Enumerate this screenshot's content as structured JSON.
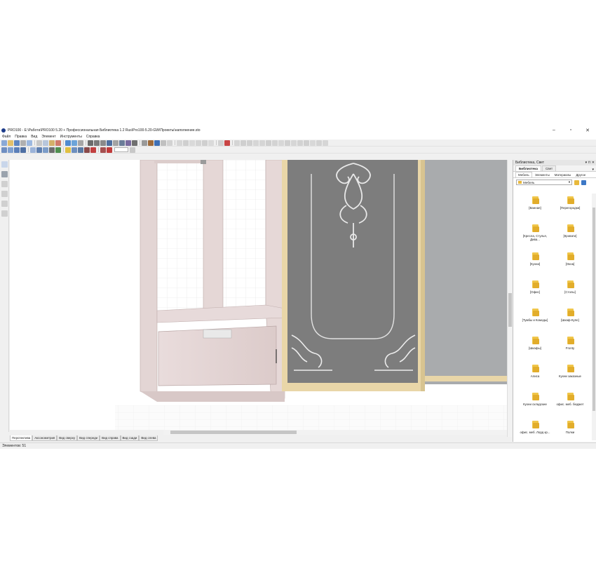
{
  "window": {
    "title": "PRO100 - E:\\Работа\\PRO100 5.20 + Профессиональная Библиотека 1.2 Rus\\Pro100-5.20-GW\\Проекты\\наполнение.sto",
    "minimize": "–",
    "maximize": "▫",
    "close": "✕"
  },
  "menu": [
    "Файл",
    "Правка",
    "Вид",
    "Элемент",
    "Инструменты",
    "Справка"
  ],
  "toolbar1_icons": [
    "new-icon",
    "open-icon",
    "save-icon",
    "print-icon",
    "print-preview-icon",
    "cut-icon",
    "copy-icon",
    "paste-icon",
    "delete-icon",
    "globe-icon",
    "web-icon",
    "properties-icon",
    "grid-icon",
    "list-icon",
    "frame-icon",
    "image-icon",
    "table-icon",
    "list2-icon",
    "report-icon",
    "sigma-icon",
    "table2-icon",
    "lift-icon",
    "rotate-icon",
    "link-icon",
    "rotate-left-icon",
    "flip-icon",
    "align-left-icon",
    "align-right-icon",
    "move-icon",
    "move2-icon",
    "align-center-icon",
    "align-icon",
    "snap-icon",
    "stop-icon",
    "dims1-icon",
    "dims2-icon",
    "dims3-icon",
    "dims4-icon",
    "dims5-icon",
    "dims6-icon",
    "dims7-icon",
    "dims8-icon",
    "dims9-icon",
    "dims10-icon",
    "dims11-icon",
    "dims12-icon",
    "dims13-icon",
    "dims14-icon"
  ],
  "toolbar2_icons": [
    "box-icon",
    "cube-icon",
    "cube2-icon",
    "cube3-icon",
    "panel-icon",
    "door-icon",
    "window-icon",
    "arrow-icon",
    "scale-icon",
    "lamp-icon",
    "dimension-icon",
    "wave-icon",
    "texture-icon",
    "magnet-icon",
    "circle-icon",
    "target-icon"
  ],
  "zoom_value": "",
  "colors": {
    "accent": "#1d3c8a",
    "folder": "#e8b93d",
    "panel_bg": "#ffffff",
    "mirror": "#a9abad",
    "glass": "#7d7d7d",
    "frame": "#e9d6a8"
  },
  "view_tabs": [
    "Перспектива",
    "Аксонометрия",
    "Вид сверху",
    "Вид спереди",
    "Вид справа",
    "Вид сзади",
    "Вид слева"
  ],
  "active_view_tab": "Перспектива",
  "status": "Элементов: 51",
  "library": {
    "title": "Библиотека, Свет",
    "pin": "▾ ⊓ ✕",
    "tabs": [
      "Библиотека",
      "Свет"
    ],
    "subtabs": [
      "Мебель",
      "Элементы",
      "Материалы",
      "Другое"
    ],
    "selected": "Мебель",
    "items": [
      "[Ванная]",
      "[Перегородки]",
      "[Кресла, Стулья, Дива...",
      "[Кровати]",
      "[Кухни]",
      "[Окна]",
      "[Офис]",
      "[Столы]",
      "[Тумбы и Комоды]",
      "[Шкаф-Купе]",
      "[Шкафы]",
      "Fronty",
      "Алиса",
      "Кухни заказные",
      "Кухни складские",
      "офис. меб. бюджет",
      "офис. меб. Лорд кр...",
      "Полки"
    ]
  }
}
